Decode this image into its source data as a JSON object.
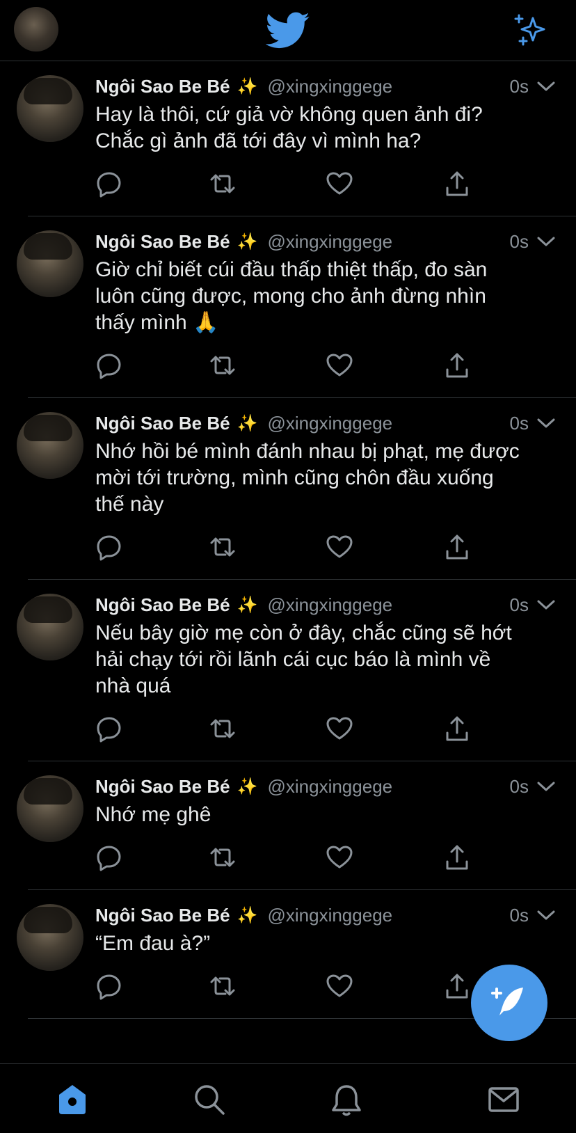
{
  "colors": {
    "accent": "#4a99e9",
    "background": "#000000",
    "text": "#e7e9ea",
    "muted": "#8b9299"
  },
  "header": {
    "logo": "twitter-bird-icon",
    "spark": "sparkle-icon"
  },
  "tweets": [
    {
      "name": "Ngôi Sao Be Bé",
      "emoji": "✨",
      "handle": "@xingxinggege",
      "time": "0s",
      "text": "Hay là thôi, cứ giả vờ không quen ảnh đi?\nChắc gì ảnh đã tới đây vì mình ha?"
    },
    {
      "name": "Ngôi Sao Be Bé",
      "emoji": "✨",
      "handle": "@xingxinggege",
      "time": "0s",
      "text": "Giờ chỉ biết cúi đầu thấp thiệt thấp, đo sàn\nluôn cũng được, mong cho ảnh đừng nhìn\nthấy mình 🙏"
    },
    {
      "name": "Ngôi Sao Be Bé",
      "emoji": "✨",
      "handle": "@xingxinggege",
      "time": "0s",
      "text": "Nhớ hồi bé mình đánh nhau bị phạt, mẹ được\nmời tới trường, mình cũng chôn đầu xuống\nthế này"
    },
    {
      "name": "Ngôi Sao Be Bé",
      "emoji": "✨",
      "handle": "@xingxinggege",
      "time": "0s",
      "text": "Nếu bây giờ mẹ còn ở đây, chắc cũng sẽ hớt\nhải chạy tới rồi lãnh cái cục báo là mình về\nnhà quá"
    },
    {
      "name": "Ngôi Sao Be Bé",
      "emoji": "✨",
      "handle": "@xingxinggege",
      "time": "0s",
      "text": "Nhớ mẹ ghê"
    },
    {
      "name": "Ngôi Sao Be Bé",
      "emoji": "✨",
      "handle": "@xingxinggege",
      "time": "0s",
      "text": "“Em đau à?”"
    }
  ],
  "tabs": [
    "home-icon",
    "search-icon",
    "bell-icon",
    "mail-icon"
  ]
}
